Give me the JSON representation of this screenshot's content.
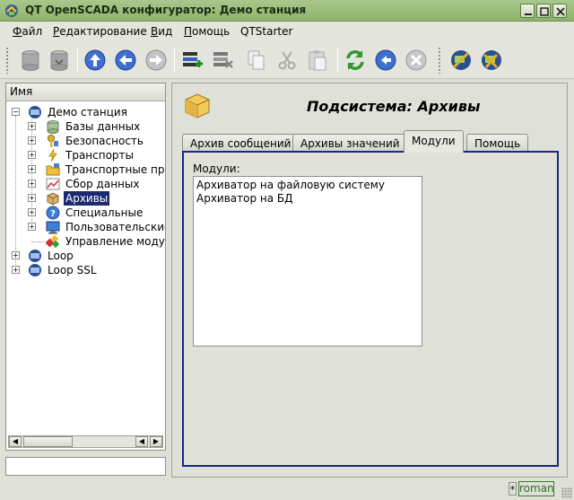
{
  "window": {
    "title": "QT OpenSCADA конфигуратор: Демо станция"
  },
  "menu": [
    {
      "label": "Файл",
      "accel": "Ф",
      "rest": "айл"
    },
    {
      "label": "Редактирование",
      "accel": "Р",
      "rest": "едактирование"
    },
    {
      "label": "Вид",
      "accel": "В",
      "rest": "ид"
    },
    {
      "label": "Помощь",
      "accel": "П",
      "rest": "омощь"
    },
    {
      "label": "QTStarter",
      "accel": "",
      "rest": "QTStarter"
    }
  ],
  "toolbar": {
    "buttons": [
      "db-load-icon",
      "db-save-icon",
      "up-icon",
      "back-icon",
      "forward-icon",
      "item-add-icon",
      "item-delete-icon",
      "copy-icon",
      "cut-icon",
      "paste-icon",
      "refresh-icon",
      "restart-icon",
      "stop-icon",
      "remote-station-icon",
      "settings-station-icon"
    ]
  },
  "tree": {
    "header": "Имя",
    "items": [
      {
        "label": "Демо станция",
        "level": 0,
        "expander": "−"
      },
      {
        "label": "Базы данных",
        "level": 1,
        "expander": "+"
      },
      {
        "label": "Безопасность",
        "level": 1,
        "expander": "+"
      },
      {
        "label": "Транспорты",
        "level": 1,
        "expander": "+"
      },
      {
        "label": "Транспортные прот",
        "level": 1,
        "expander": "+"
      },
      {
        "label": "Сбор данных",
        "level": 1,
        "expander": "+"
      },
      {
        "label": "Архивы",
        "level": 1,
        "expander": "+",
        "selected": true
      },
      {
        "label": "Специальные",
        "level": 1,
        "expander": "+"
      },
      {
        "label": "Пользовательские",
        "level": 1,
        "expander": "+"
      },
      {
        "label": "Управление модул",
        "level": 1,
        "expander": ""
      },
      {
        "label": "Loop",
        "level": 0,
        "expander": "+"
      },
      {
        "label": "Loop SSL",
        "level": 0,
        "expander": "+"
      }
    ]
  },
  "page": {
    "title": "Подсистема: Архивы",
    "tabs": [
      "Архив сообщений",
      "Архивы значений",
      "Модули",
      "Помощь"
    ],
    "active_tab": "Модули",
    "modules_label": "Модули:",
    "modules": [
      "Архиватор на файловую систему",
      "Архиватор на БД"
    ]
  },
  "status": {
    "modified": "*",
    "user": "roman"
  },
  "colors": {
    "title_bar": "#9cbf7c",
    "selection": "#1c2a6e",
    "tab_frame": "#1d2680"
  }
}
